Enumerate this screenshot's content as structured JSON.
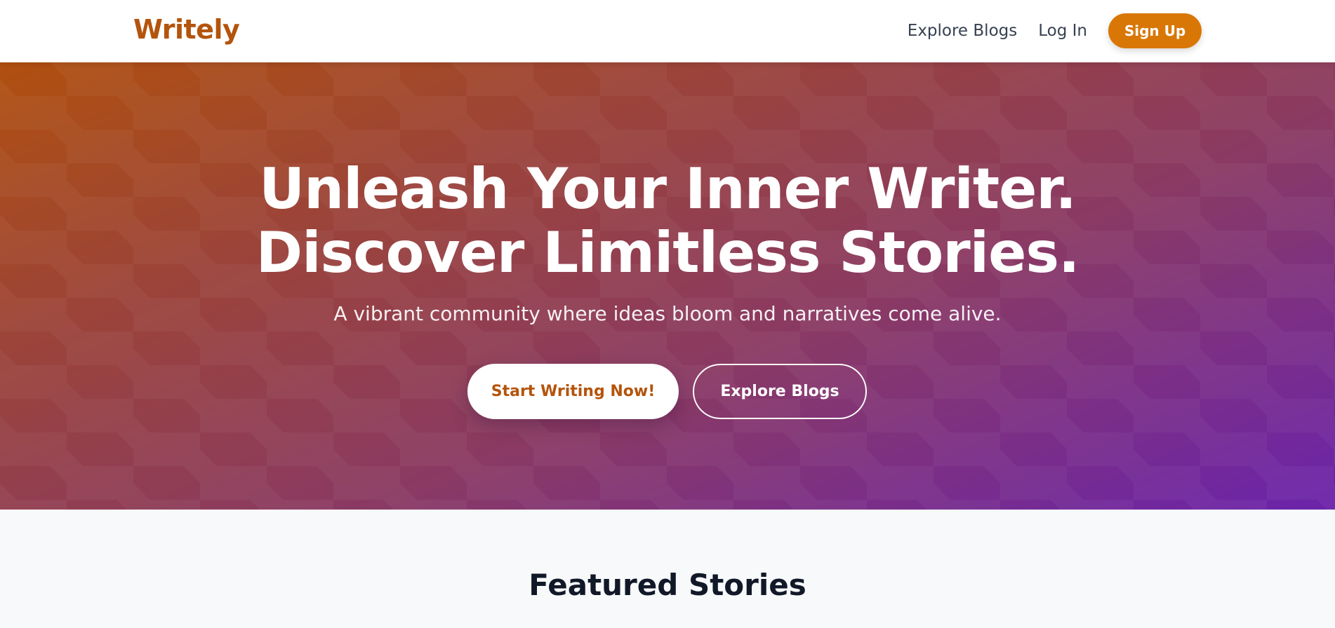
{
  "header": {
    "logo": "Writely",
    "nav": {
      "explore": "Explore Blogs",
      "login": "Log In",
      "signup": "Sign Up"
    }
  },
  "hero": {
    "title_line1": "Unleash Your Inner Writer.",
    "title_line2": "Discover Limitless Stories.",
    "subtitle": "A vibrant community where ideas bloom and narratives come alive.",
    "primary_button": "Start Writing Now!",
    "secondary_button": "Explore Blogs"
  },
  "featured": {
    "title": "Featured Stories"
  },
  "colors": {
    "brand": "#b4540c",
    "accent": "#d97706",
    "gradient_start": "#b0500f",
    "gradient_end": "#6b23ab"
  }
}
